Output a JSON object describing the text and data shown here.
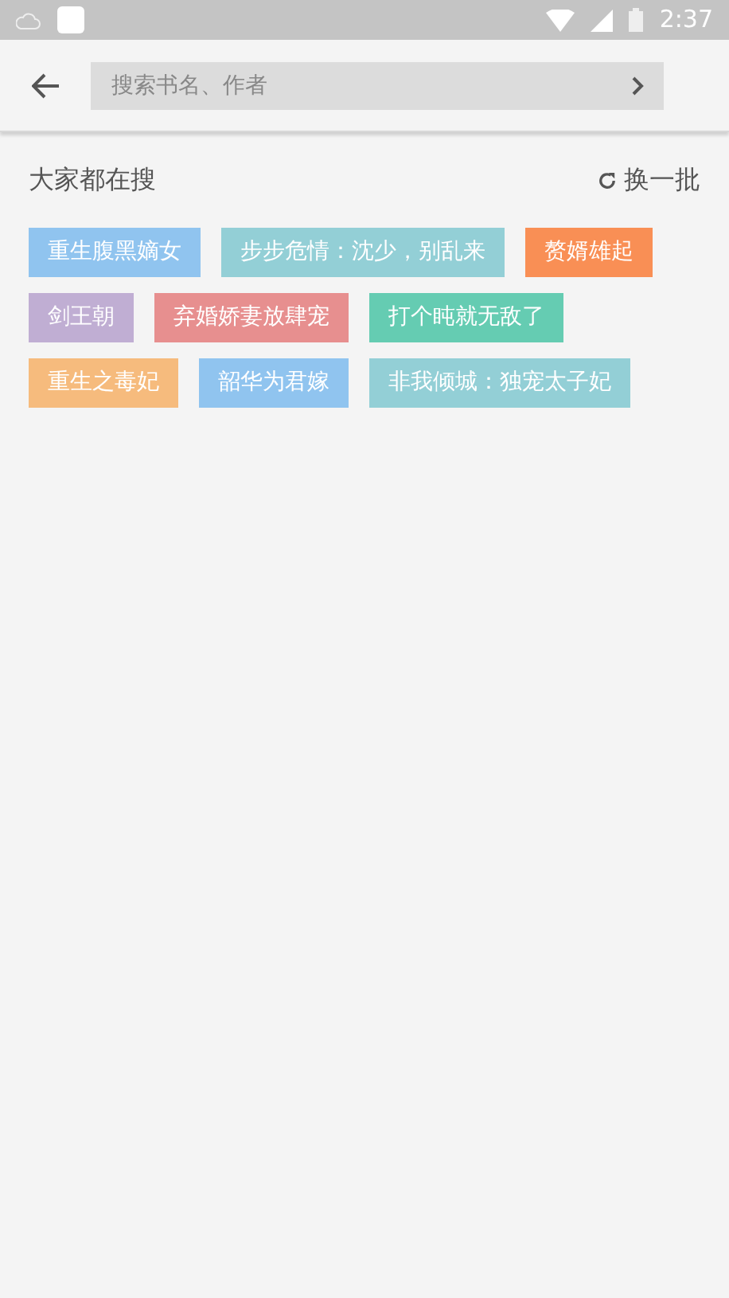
{
  "status_bar": {
    "time": "2:37"
  },
  "search": {
    "placeholder": "搜索书名、作者"
  },
  "hot": {
    "title": "大家都在搜",
    "refresh": "换一批",
    "tags": [
      {
        "label": "重生腹黑嫡女",
        "color": "#90c4ef"
      },
      {
        "label": "步步危情：沈少，别乱来",
        "color": "#93cfd6"
      },
      {
        "label": "赘婿雄起",
        "color": "#f98f55"
      },
      {
        "label": "剑王朝",
        "color": "#c0aed3"
      },
      {
        "label": "弃婚娇妻放肆宠",
        "color": "#e78f8f"
      },
      {
        "label": "打个盹就无敌了",
        "color": "#65ccb2"
      },
      {
        "label": "重生之毒妃",
        "color": "#f6bb7d"
      },
      {
        "label": "韶华为君嫁",
        "color": "#90c4ef"
      },
      {
        "label": "非我倾城：独宠太子妃",
        "color": "#93cfd6"
      }
    ]
  }
}
